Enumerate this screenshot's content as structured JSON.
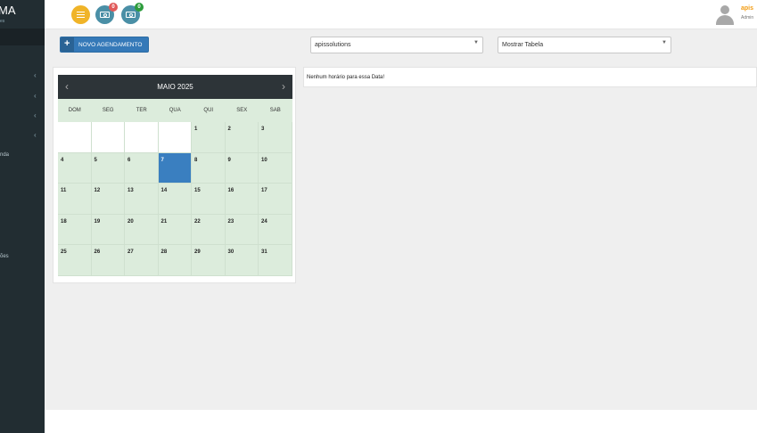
{
  "sidebar": {
    "brand": "MA",
    "brand_sub": "es",
    "labels": [
      "nda",
      "ões"
    ]
  },
  "topbar": {
    "badges": {
      "money1": "0",
      "money2": "0"
    },
    "user": {
      "name": "apis",
      "role": "Admin"
    },
    "icons": [
      "menu-icon",
      "money-icon",
      "money-icon",
      "user-avatar-icon"
    ]
  },
  "toolbar": {
    "new_button_label": "NOVO AGENDAMENTO",
    "company_select": "apissolutions",
    "view_select": "Mostrar Tabela"
  },
  "calendar": {
    "month_title": "MAIO 2025",
    "weekdays": [
      "DOM",
      "SEG",
      "TER",
      "QUA",
      "QUI",
      "SEX",
      "SAB"
    ],
    "first_weekday_index": 4,
    "days_in_month": 31,
    "selected_day": 7
  },
  "schedule": {
    "empty_message": "Nenhum horário para essa Data!"
  },
  "colors": {
    "sidebar": "#222d32",
    "primary": "#3579b8",
    "calendar_cell": "#dcecdc",
    "accent_yellow": "#f0b428",
    "selected_day": "#3a7fc0"
  }
}
